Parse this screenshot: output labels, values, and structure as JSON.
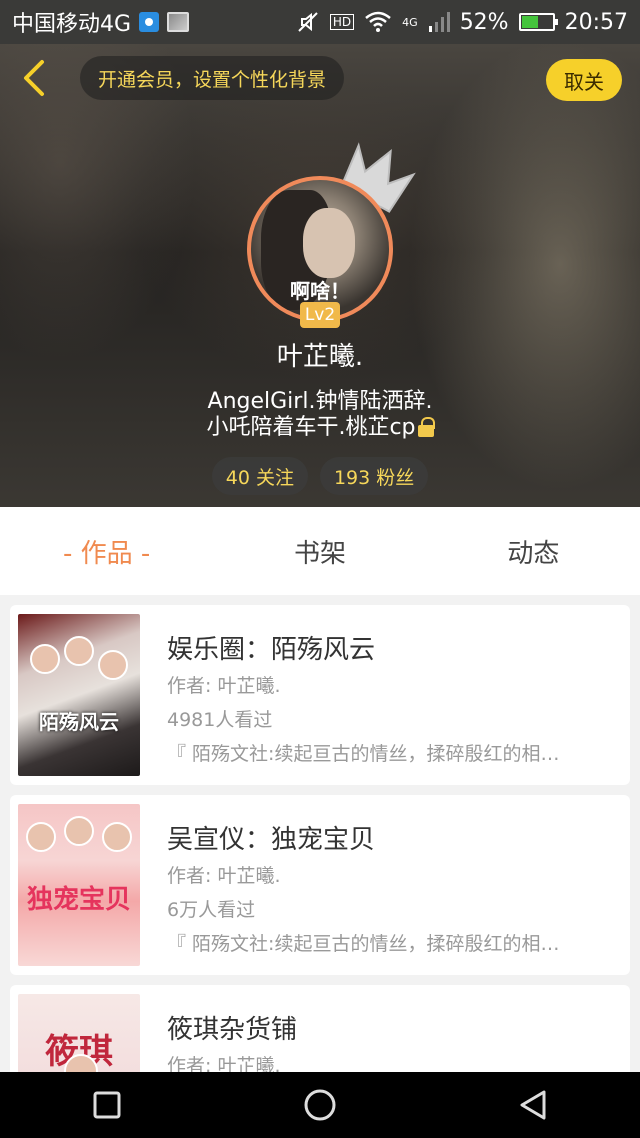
{
  "status_bar": {
    "carrier": "中国移动4G",
    "network_badge": "4G",
    "hd_badge": "HD",
    "battery_percent": "52%",
    "time": "20:57",
    "icons": [
      "location-icon",
      "image-icon",
      "mute-icon",
      "wifi-icon",
      "signal-icon",
      "battery-icon"
    ]
  },
  "header": {
    "vip_prompt": "开通会员，设置个性化背景",
    "unfollow_label": "取关",
    "level": "Lv2",
    "avatar_caption": "啊啥！",
    "username": "叶芷曦.",
    "bio_line1": "AngelGirl.钟情陆洒辞.",
    "bio_line2": "小吒陪着车干.桃芷cp",
    "following": "40 关注",
    "followers": "193 粉丝"
  },
  "tabs": [
    {
      "label": "- 作品 -",
      "active": true
    },
    {
      "label": "书架",
      "active": false
    },
    {
      "label": "动态",
      "active": false
    }
  ],
  "works": [
    {
      "title": "娱乐圈：陌殇风云",
      "author": "作者: 叶芷曦.",
      "views": "4981人看过",
      "description": "『 陌殇文社:续起亘古的情丝，揉碎殷红的相…",
      "cover_text": "陌殇风云"
    },
    {
      "title": "吴宣仪：独宠宝贝",
      "author": "作者: 叶芷曦.",
      "views": "6万人看过",
      "description": "『 陌殇文社:续起亘古的情丝，揉碎殷红的相…",
      "cover_text": "独宠宝贝"
    },
    {
      "title": "筱琪杂货铺",
      "author": "作者: 叶芷曦.",
      "views": "",
      "description": "",
      "cover_text": "筱琪"
    }
  ],
  "colors": {
    "accent_orange": "#f08a4f",
    "vip_yellow": "#f6d75a",
    "unfollow_yellow": "#f6d02a"
  }
}
